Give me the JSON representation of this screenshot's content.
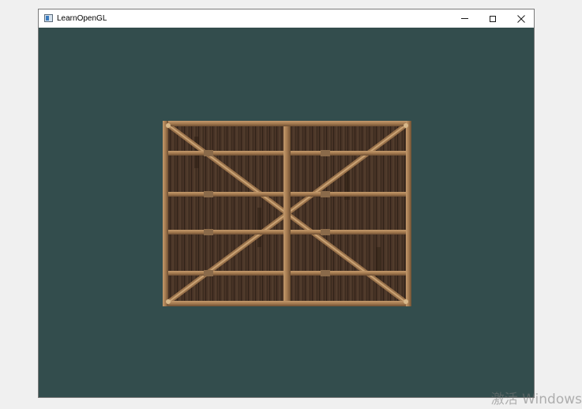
{
  "window": {
    "title": "LearnOpenGL",
    "icon": "opengl-app-icon",
    "buttons": {
      "minimize_icon": "minimize-icon",
      "maximize_icon": "maximize-icon",
      "close_icon": "close-icon"
    }
  },
  "viewport": {
    "clear_color": "#334d4d",
    "object": "wooden-container-texture"
  },
  "watermark": {
    "text": "激活 Windows"
  }
}
